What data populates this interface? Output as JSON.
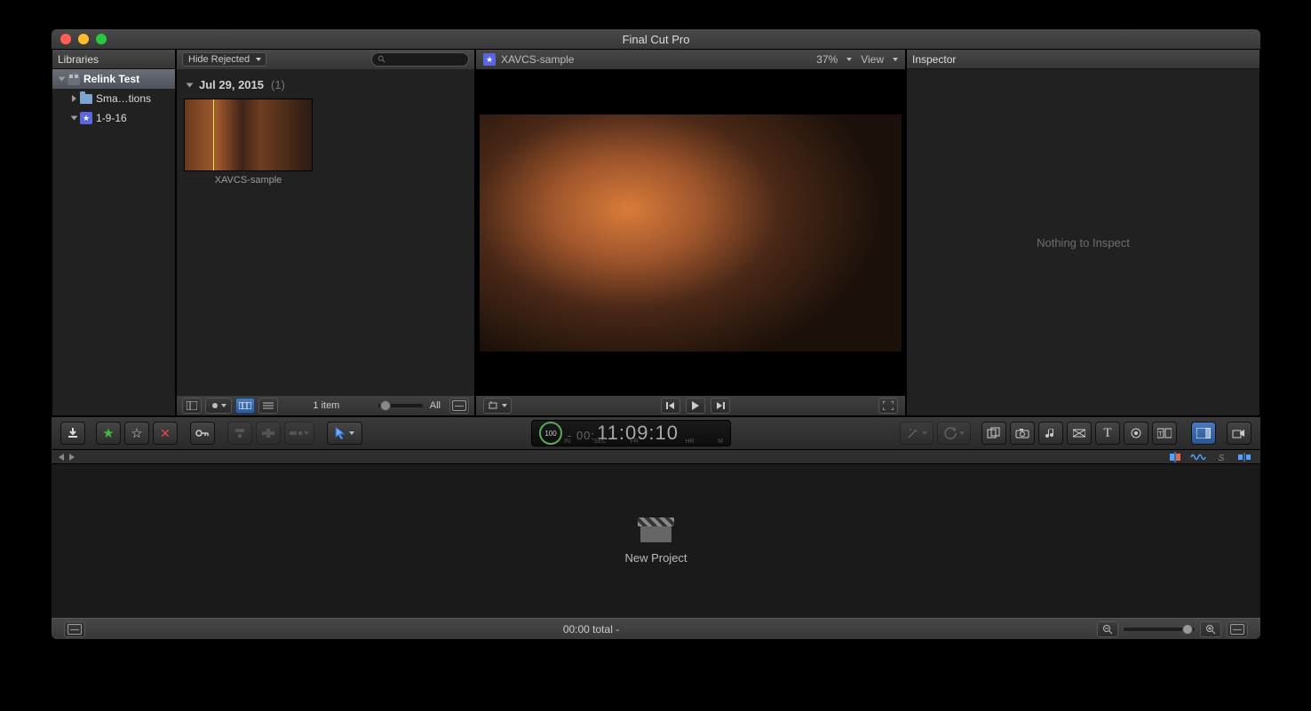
{
  "app_title": "Final Cut Pro",
  "libraries": {
    "header": "Libraries",
    "tree": [
      {
        "label": "Relink Test",
        "type": "library",
        "expanded": true,
        "selected": true,
        "depth": 0
      },
      {
        "label": "Sma…tions",
        "type": "folder",
        "expanded": false,
        "depth": 1
      },
      {
        "label": "1-9-16",
        "type": "event",
        "expanded": true,
        "depth": 1
      }
    ]
  },
  "browser": {
    "filter_label": "Hide Rejected",
    "group_date": "Jul 29, 2015",
    "group_count": "(1)",
    "clip_name": "XAVCS-sample",
    "footer_count": "1 item",
    "footer_zoom_label": "All"
  },
  "viewer": {
    "clip_title": "XAVCS-sample",
    "zoom": "37%",
    "view_label": "View"
  },
  "inspector": {
    "header": "Inspector",
    "empty_text": "Nothing to Inspect"
  },
  "toolbar": {
    "gauge_value": "100",
    "timecode": "11:09:10",
    "tc_prefix": "- 00:",
    "tc_labels": [
      "IN",
      "SEC",
      "FR",
      "",
      "HR",
      "M"
    ]
  },
  "timeline": {
    "new_project_label": "New Project"
  },
  "statusbar": {
    "duration": "00:00 total -"
  }
}
